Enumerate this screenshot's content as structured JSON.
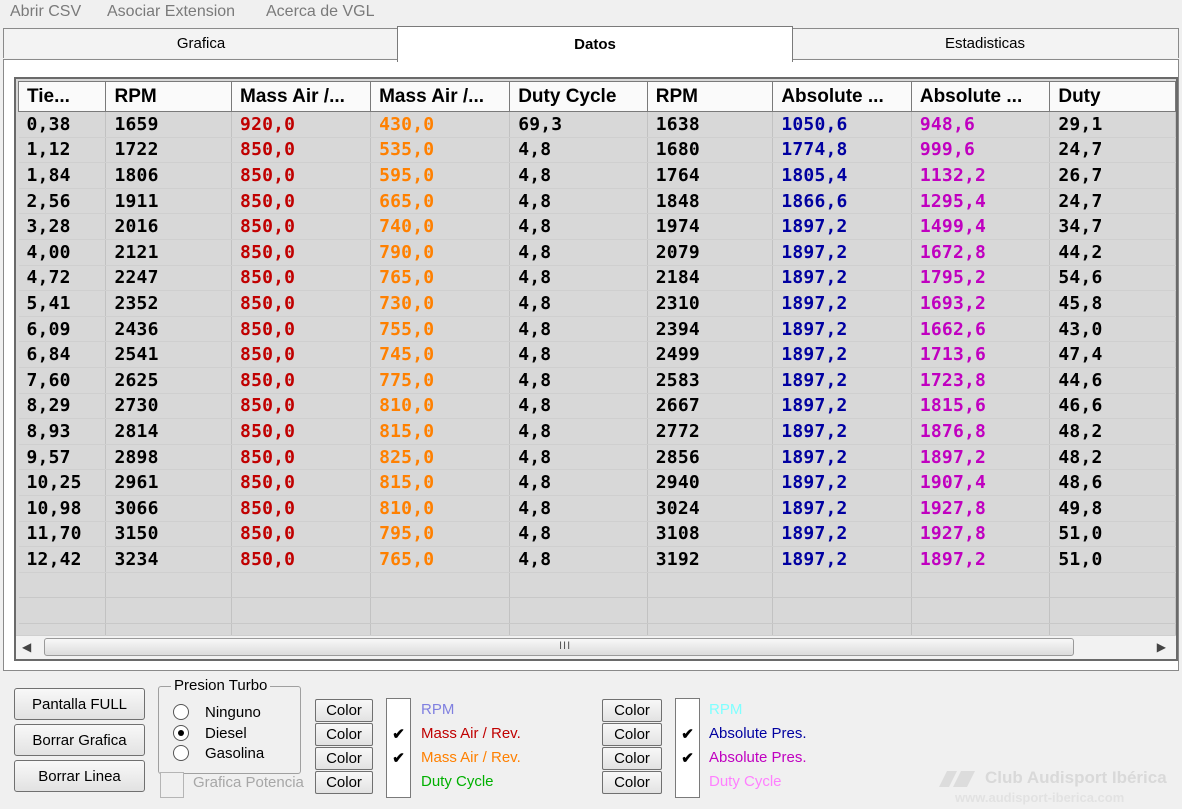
{
  "menu": {
    "items": [
      "Abrir CSV",
      "Asociar Extension",
      "Acerca de VGL"
    ]
  },
  "tabs": [
    {
      "label": "Grafica",
      "active": false
    },
    {
      "label": "Datos",
      "active": true
    },
    {
      "label": "Estadisticas",
      "active": false
    }
  ],
  "table": {
    "columns": [
      "Tie...",
      "RPM",
      "Mass Air /...",
      "Mass Air /...",
      "Duty Cycle",
      "RPM",
      "Absolute ...",
      "Absolute ...",
      "Duty"
    ],
    "column_colors": [
      "#000000",
      "#000000",
      "#c00000",
      "#ff8000",
      "#000000",
      "#000000",
      "#0000a0",
      "#c000c0",
      "#000000"
    ],
    "rows": [
      [
        "0,38",
        "1659",
        "920,0",
        "430,0",
        "69,3",
        "1638",
        "1050,6",
        "948,6",
        "29,1"
      ],
      [
        "1,12",
        "1722",
        "850,0",
        "535,0",
        "4,8",
        "1680",
        "1774,8",
        "999,6",
        "24,7"
      ],
      [
        "1,84",
        "1806",
        "850,0",
        "595,0",
        "4,8",
        "1764",
        "1805,4",
        "1132,2",
        "26,7"
      ],
      [
        "2,56",
        "1911",
        "850,0",
        "665,0",
        "4,8",
        "1848",
        "1866,6",
        "1295,4",
        "24,7"
      ],
      [
        "3,28",
        "2016",
        "850,0",
        "740,0",
        "4,8",
        "1974",
        "1897,2",
        "1499,4",
        "34,7"
      ],
      [
        "4,00",
        "2121",
        "850,0",
        "790,0",
        "4,8",
        "2079",
        "1897,2",
        "1672,8",
        "44,2"
      ],
      [
        "4,72",
        "2247",
        "850,0",
        "765,0",
        "4,8",
        "2184",
        "1897,2",
        "1795,2",
        "54,6"
      ],
      [
        "5,41",
        "2352",
        "850,0",
        "730,0",
        "4,8",
        "2310",
        "1897,2",
        "1693,2",
        "45,8"
      ],
      [
        "6,09",
        "2436",
        "850,0",
        "755,0",
        "4,8",
        "2394",
        "1897,2",
        "1662,6",
        "43,0"
      ],
      [
        "6,84",
        "2541",
        "850,0",
        "745,0",
        "4,8",
        "2499",
        "1897,2",
        "1713,6",
        "47,4"
      ],
      [
        "7,60",
        "2625",
        "850,0",
        "775,0",
        "4,8",
        "2583",
        "1897,2",
        "1723,8",
        "44,6"
      ],
      [
        "8,29",
        "2730",
        "850,0",
        "810,0",
        "4,8",
        "2667",
        "1897,2",
        "1815,6",
        "46,6"
      ],
      [
        "8,93",
        "2814",
        "850,0",
        "815,0",
        "4,8",
        "2772",
        "1897,2",
        "1876,8",
        "48,2"
      ],
      [
        "9,57",
        "2898",
        "850,0",
        "825,0",
        "4,8",
        "2856",
        "1897,2",
        "1897,2",
        "48,2"
      ],
      [
        "10,25",
        "2961",
        "850,0",
        "815,0",
        "4,8",
        "2940",
        "1897,2",
        "1907,4",
        "48,6"
      ],
      [
        "10,98",
        "3066",
        "850,0",
        "810,0",
        "4,8",
        "3024",
        "1897,2",
        "1927,8",
        "49,8"
      ],
      [
        "11,70",
        "3150",
        "850,0",
        "795,0",
        "4,8",
        "3108",
        "1897,2",
        "1927,8",
        "51,0"
      ],
      [
        "12,42",
        "3234",
        "850,0",
        "765,0",
        "4,8",
        "3192",
        "1897,2",
        "1897,2",
        "51,0"
      ]
    ],
    "scrollbar_grip": "III"
  },
  "controls": {
    "pantalla_full_label": "Pantalla  FULL",
    "borrar_grafica_label": "Borrar Grafica",
    "borrar_linea_label": "Borrar Linea",
    "presion_turbo": {
      "title": "Presion Turbo",
      "options": [
        "Ninguno",
        "Diesel",
        "Gasolina"
      ],
      "selected": "Diesel"
    },
    "grafica_potencia_label": "Grafica Potencia",
    "color_button_label": "Color",
    "series_left": [
      {
        "label": "RPM",
        "checked": false,
        "color": "#8080e0"
      },
      {
        "label": "Mass Air / Rev.",
        "checked": true,
        "color": "#c00000"
      },
      {
        "label": "Mass Air / Rev.",
        "checked": true,
        "color": "#ff8000"
      },
      {
        "label": "Duty Cycle",
        "checked": false,
        "color": "#00b000"
      }
    ],
    "series_right": [
      {
        "label": "RPM",
        "checked": false,
        "color": "#80ffff"
      },
      {
        "label": "Absolute Pres.",
        "checked": true,
        "color": "#0000a0"
      },
      {
        "label": "Absolute Pres.",
        "checked": true,
        "color": "#c000c0"
      },
      {
        "label": "Duty Cycle",
        "checked": false,
        "color": "#ff80ff"
      }
    ],
    "check_mark": "✔"
  },
  "watermark": {
    "name": "Club Audisport Ibérica",
    "url": "www.audisport-iberica.com"
  }
}
